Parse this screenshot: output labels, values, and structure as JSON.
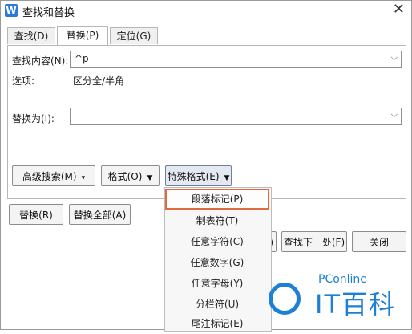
{
  "window": {
    "title": "查找和替换",
    "close_glyph": "✕",
    "icon_letter": "W"
  },
  "tabs": [
    {
      "label": "查找(D)"
    },
    {
      "label": "替换(P)",
      "active": true
    },
    {
      "label": "定位(G)"
    }
  ],
  "find": {
    "label": "查找内容(N):",
    "value": "^p"
  },
  "options": {
    "label": "选项:",
    "value": "区分全/半角"
  },
  "replace": {
    "label": "替换为(I):",
    "value": ""
  },
  "buttons": {
    "advanced_search": "高级搜索(M)",
    "format": "格式(O)",
    "special_format": "特殊格式(E)",
    "replace": "替换(R)",
    "replace_all": "替换全部(A)",
    "find_next": "查找下一处(F)",
    "close": "关闭",
    "partial_left": "C)"
  },
  "special_menu": [
    "段落标记(P)",
    "制表符(T)",
    "任意字符(C)",
    "任意数字(G)",
    "任意字母(Y)",
    "分栏符(U)",
    "尾注标记(E)"
  ],
  "watermark": {
    "brand_small": "PConline",
    "brand_big": "IT百科"
  },
  "colors": {
    "accent": "#e1693e",
    "brand": "#1d7fd6"
  }
}
